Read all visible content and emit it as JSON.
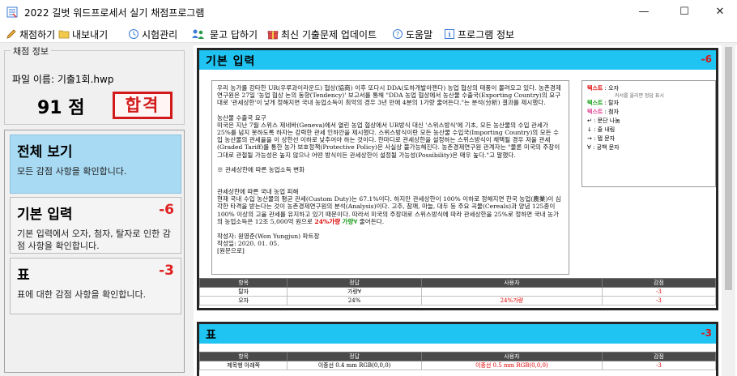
{
  "window": {
    "title": "2022 길벗 워드프로세서 실기 채점프로그램",
    "minimize": "—",
    "maximize": "☐",
    "close": "✕"
  },
  "menu": {
    "items": [
      {
        "label": "채점하기",
        "icon": "pencil-icon"
      },
      {
        "label": "내보내기",
        "icon": "folder-icon"
      },
      {
        "label": "시험관리",
        "icon": "clock-icon"
      },
      {
        "label": "묻고 답하기",
        "icon": "people-icon"
      },
      {
        "label": "최신 기출문제 업데이트",
        "icon": "gift-icon"
      },
      {
        "label": "도움말",
        "icon": "help-icon"
      },
      {
        "label": "프로그램 정보",
        "icon": "info-icon"
      }
    ]
  },
  "summary": {
    "group_title": "채점 정보",
    "file_label": "파일 이름: 기출1회.hwp",
    "score": "91 점",
    "stamp": "합격"
  },
  "categories": [
    {
      "title": "전체 보기",
      "score": "",
      "desc": "모든 감점 사항을 확인합니다."
    },
    {
      "title": "기본 입력",
      "score": "-6",
      "desc": "기본 입력에서 오자, 첨자, 탈자로 인한 감점 사항을 확인합니다."
    },
    {
      "title": "표",
      "score": "-3",
      "desc": "표에 대한 감점 사항을 확인합니다."
    }
  ],
  "sections": {
    "basic": {
      "title": "기본 입력",
      "score": "-6",
      "doc": {
        "p1": "우리 농가를 강타한 UR(우루과이라운드) 협상(協商) 이후 또다시 DDA(도하개발아젠다) 농업 협상의 태풍이 몰려오고 있다. 농촌경제연구원은 27일 '농업 협상 논의 동향(Tendency)' 보고서를 통해 \"DDA 농업 협상에서 농산물 수출국(Exporting Country)의 요구대로 '관세상한'이 낮게 정해지면 국내 농업소득이 최악의 경우 3년 만에 4분의 1가량 줄어든다.\"는 분석(分析) 결과를 제시했다.",
        "p2": "농산물 수출국 요구",
        "p3": "미국은 지난 7월 스위스 제네바(Geneva)에서 열린 농업 협상에서 UR방식 대신 '스위스방식'에 기초, 모든 농산물의 수입 관세가 25%를 넘지 못하도록 하자는 강력한 관세 인하안을 제시했다. 스위스방식이란 모든 농산물 수입국(Importing Country)의 모든 수입 농산물의 관세율을 이 상한선 이하로 낮추어야 하는 것이다. 한마디로 관세상한을 설정하는 스위스방식이 채택될 경우 저율 관세(Graded Tariff)를 통한 농가 보호정책(Protective Policy)은 사실상 불가능해진다. 농촌경제연구원 관계자는 \"물론 미국의 주장이 그대로 관철될 가능성은 높지 않으나 어떤 방식이든 관세상한이 설정될 가능성(Possibility)은 매우 높다.\"고 말했다.",
        "p4": "※ 관세상한에 따른 농업소득 변화",
        "p5": "관세상한에 따른 국내 농업 피해",
        "p6a": "현재 국내 수입 농산물의 평균 관세(Custom Duty)는 67.1%이다. 하지만 관세상한이 100% 이하로 정해지면 한국 농업(農業)이 심각한 타격을 받는다는 것이 농촌경제연구원의 분석(Analysis)이다. 고추, 참깨, 마늘, 대두 등 주요 곡물(Cereals)과 양념 125종이 100% 이상의 고율 관세를 유지하고 있기 때문이다. 따라서 미국의 주장대로 스위스방식에 따라 관세상한을 25%로 정하면 국내 농가의 농업소득은 12조 5,000억 원으로",
        "p6_err": "24%가량",
        "p6_ok": "가량∀",
        "p6b": "줄어든다.",
        "p7": "작성자: 원영준(Won Yungjun) 파트장",
        "p8": "작성일: 2020. 01. 05.",
        "p9": "[원문으로]"
      },
      "legend": [
        {
          "label": "텍스트",
          "text": " : 오자",
          "style": "red"
        },
        {
          "label": "",
          "text": "커서를 올리면 정답 표시",
          "style": "note"
        },
        {
          "label": "텍스트",
          "text": " : 탈자",
          "style": "green"
        },
        {
          "label": "텍스트",
          "text": " : 첨자",
          "style": "pink"
        },
        {
          "label": "↵",
          "text": " : 문단 나눔",
          "style": "plain"
        },
        {
          "label": "↓",
          "text": " : 줄 내림",
          "style": "plain"
        },
        {
          "label": "→",
          "text": " : 탭 문자",
          "style": "plain"
        },
        {
          "label": "∀",
          "text": " : 공백 문자",
          "style": "plain"
        }
      ],
      "table": {
        "headers": [
          "항목",
          "정답",
          "사용자",
          "감점"
        ],
        "rows": [
          [
            "탈자",
            "가량∀",
            "",
            "-3"
          ],
          [
            "오자",
            "24%",
            "24%가량",
            "-3"
          ]
        ]
      }
    },
    "table": {
      "title": "표",
      "score": "-3",
      "table": {
        "headers": [
          "항목",
          "정답",
          "사용자",
          "감점"
        ],
        "rows": [
          [
            "제목행 아래쪽",
            "이중선 0.4 mm RGB(0,0,0)",
            "이중선 0.5 mm RGB(0,0,0)",
            "-3"
          ]
        ]
      }
    }
  }
}
